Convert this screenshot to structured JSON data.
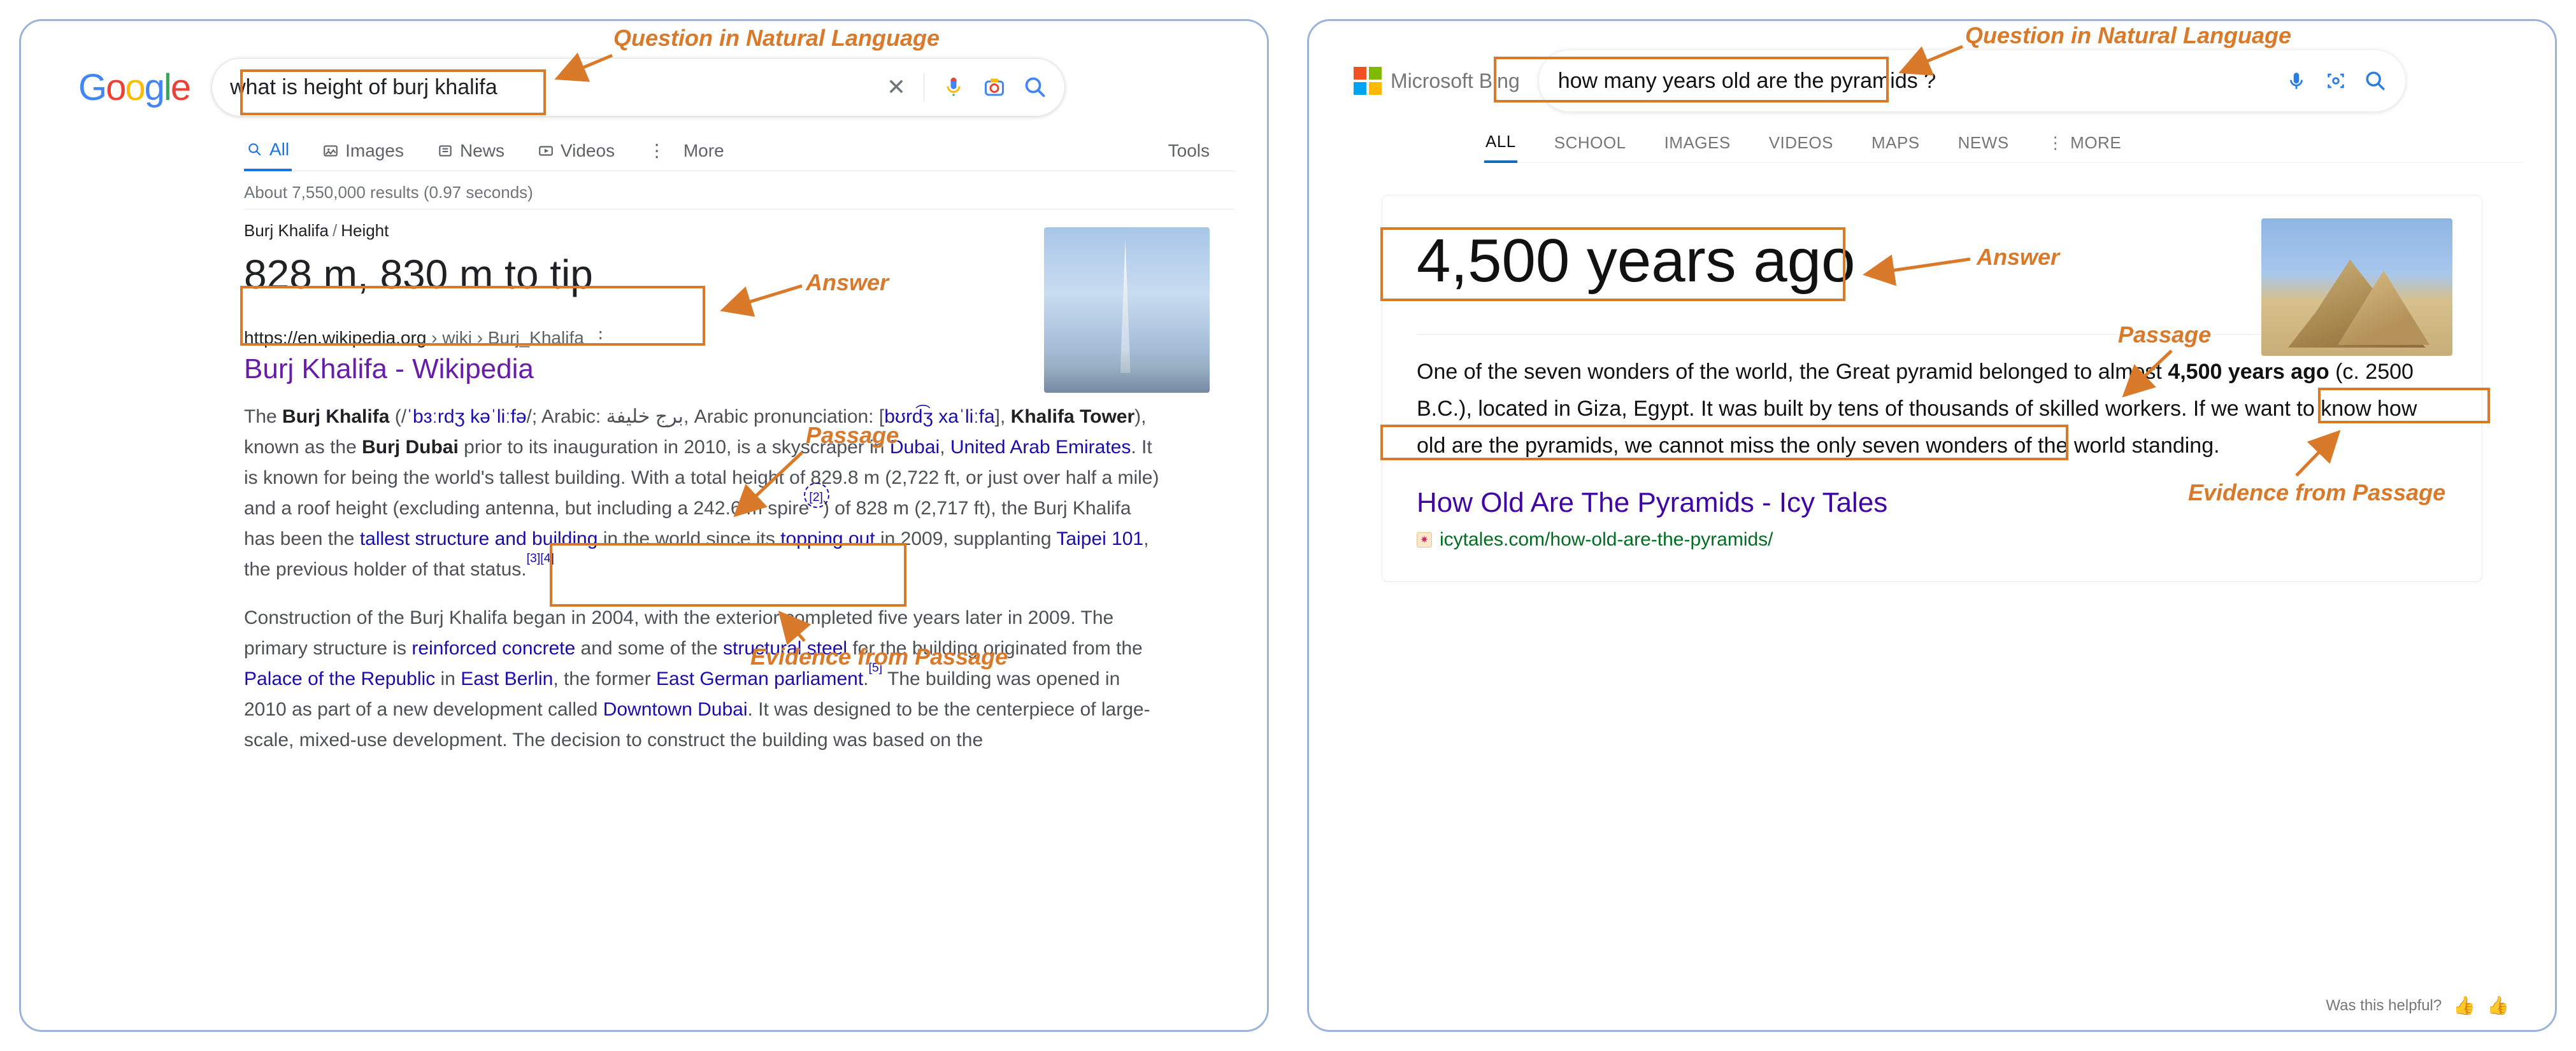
{
  "annotations": {
    "question": "Question in Natural Language",
    "answer": "Answer",
    "passage": "Passage",
    "evidence": "Evidence from Passage"
  },
  "google": {
    "logo_letters": [
      "G",
      "o",
      "o",
      "g",
      "l",
      "e"
    ],
    "search_query": "what is height of burj khalifa",
    "tabs": {
      "all": "All",
      "images": "Images",
      "news": "News",
      "videos": "Videos",
      "more": "More",
      "tools": "Tools"
    },
    "result_stats": "About 7,550,000 results (0.97 seconds)",
    "crumb_entity": "Burj Khalifa",
    "crumb_attribute": "Height",
    "featured_answer": "828 m, 830 m to tip",
    "url_domain": "https://en.wikipedia.org",
    "url_path": " › wiki › Burj_Khalifa",
    "result_title": "Burj Khalifa - Wikipedia",
    "snippet": {
      "p1_a": "The ",
      "p1_bold1": "Burj Khalifa",
      "p1_b": " (/",
      "p1_ipa1": "ˈbɜːrdʒ kəˈliːfə",
      "p1_c": "/; Arabic: برج خليفة, Arabic pronunciation: [",
      "p1_ipa2": "bʊrd͡ʒ xaˈliːfa",
      "p1_d": "], ",
      "p1_bold2": "Khalifa Tower",
      "p1_e": "), known as the ",
      "p1_bold3": "Burj Dubai",
      "p1_f": " prior to its inauguration in 2010, is a skyscraper in ",
      "p1_link_dubai": "Dubai",
      "p1_comma": ", ",
      "p1_link_uae": "United Arab Emirates",
      "p1_g": ". It is known for being the world's tallest building. With a total height of 829.8 m (2,722 ft, or just over half a mile) and a roof height (excluding antenna, but including a 242.6 m spire",
      "p1_ref2": "[2]",
      "p1_h": ") of 828 m (2,717 ft), the Burj Khalifa has been the ",
      "p1_link_tallest": "tallest structure and building",
      "p1_i": " in the world since its ",
      "p1_link_topping": "topping out",
      "p1_j": " in 2009, supplanting ",
      "p1_link_taipei": "Taipei 101",
      "p1_k": ", the previous holder of that status.",
      "p1_ref3": "[3]",
      "p1_ref4": "[4]",
      "p2_a": "Construction of the Burj Khalifa began in 2004, with the exterior completed five years later in 2009. The primary structure is ",
      "p2_link_rc": "reinforced concrete",
      "p2_b": " and some of the ",
      "p2_link_ss": "structural steel",
      "p2_c": " for the building originated from the ",
      "p2_link_palace": "Palace of the Republic",
      "p2_d": " in ",
      "p2_link_eb": "East Berlin",
      "p2_e": ", the former ",
      "p2_link_egp": "East German parliament",
      "p2_f": ".",
      "p2_ref5": "[5]",
      "p2_g": " The building was opened in 2010 as part of a new development called ",
      "p2_link_dd": "Downtown Dubai",
      "p2_h": ". It was designed to be the centerpiece of large-scale, mixed-use development. The decision to construct the building was based on the"
    }
  },
  "bing": {
    "logo_text": "Microsoft Bing",
    "search_query": "how many years old are the pyramids ?",
    "tabs": {
      "all": "ALL",
      "school": "SCHOOL",
      "images": "IMAGES",
      "videos": "VIDEOS",
      "maps": "MAPS",
      "news": "NEWS",
      "more": "MORE"
    },
    "big_answer": "4,500 years ago",
    "snippet_a": "One of the seven wonders of the world, the Great pyramid belonged to almost ",
    "snippet_bold": "4,500 years ago",
    "snippet_b": " (c. 2500 B.C.), located in Giza, Egypt. It was built by tens of thousands of skilled workers. If we want to know how old are the pyramids, we cannot miss the only seven wonders of the world standing.",
    "result_title": "How Old Are The Pyramids - Icy Tales",
    "result_url": "icytales.com/how-old-are-the-pyramids/",
    "helpful": "Was this helpful?"
  }
}
